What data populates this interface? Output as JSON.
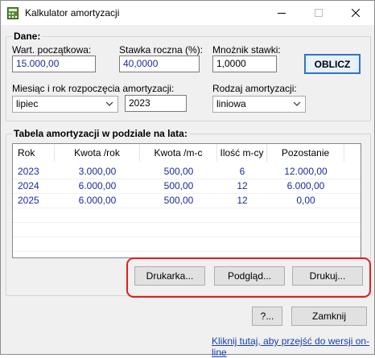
{
  "window": {
    "title": "Kalkulator amortyzacji"
  },
  "dane": {
    "group_title": "Dane:",
    "wartosc_label": "Wart. początkowa:",
    "wartosc_value": "15.000,00",
    "stawka_label": "Stawka roczna (%):",
    "stawka_value": "40,0000",
    "mnoznik_label": "Mnożnik stawki:",
    "mnoznik_value": "1,0000",
    "oblicz_label": "OBLICZ",
    "miesiac_label": "Miesiąc i rok rozpoczęcia amortyzacji:",
    "miesiac_value": "lipiec",
    "rok_value": "2023",
    "rodzaj_label": "Rodzaj amortyzacji:",
    "rodzaj_value": "liniowa"
  },
  "tabela": {
    "group_title": "Tabela amortyzacji w podziale na lata:",
    "columns": [
      "Rok",
      "Kwota /rok",
      "Kwota /m-c",
      "Ilość m-cy",
      "Pozostanie"
    ],
    "rows": [
      [
        "2023",
        "3.000,00",
        "500,00",
        "6",
        "12.000,00"
      ],
      [
        "2024",
        "6.000,00",
        "500,00",
        "12",
        "6.000,00"
      ],
      [
        "2025",
        "6.000,00",
        "500,00",
        "12",
        "0,00"
      ]
    ],
    "drukarka_label": "Drukarka...",
    "podglad_label": "Podgląd...",
    "drukuj_label": "Drukuj..."
  },
  "footer": {
    "help_label": "?...",
    "zamknij_label": "Zamknij",
    "link_text": "Kliknij tutaj, aby przejść do wersji on-line"
  },
  "colors": {
    "accent": "#2f73c9",
    "highlight": "#e01e1e",
    "value_text": "#1c2b9e"
  },
  "icons": [
    "calculator-icon",
    "minimize-icon",
    "maximize-icon",
    "close-icon",
    "chevron-down-icon"
  ]
}
